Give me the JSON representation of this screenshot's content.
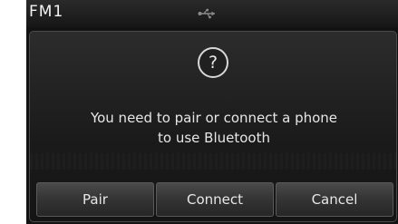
{
  "status_bar": {
    "source": "FM1",
    "usb_icon": "usb-icon"
  },
  "dialog": {
    "icon": "question-mark-icon",
    "icon_glyph": "?",
    "message": "You need to pair or connect a phone\nto use Bluetooth",
    "buttons": {
      "pair": "Pair",
      "connect": "Connect",
      "cancel": "Cancel"
    }
  }
}
